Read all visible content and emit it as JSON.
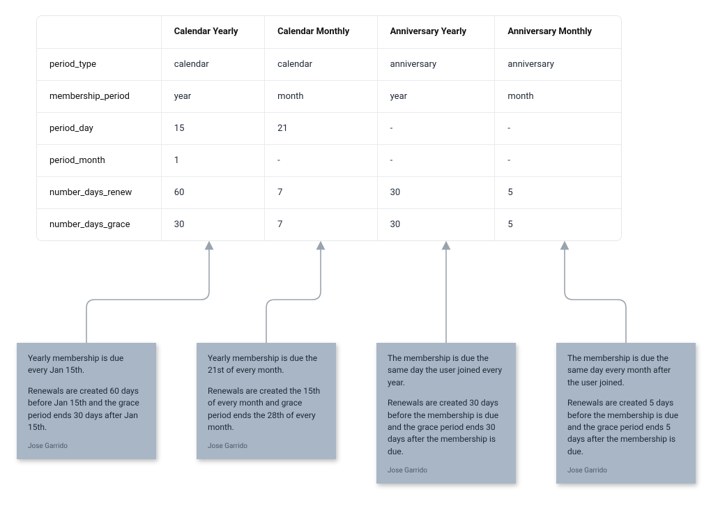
{
  "table": {
    "headers": [
      "",
      "Calendar Yearly",
      "Calendar Monthly",
      "Anniversary Yearly",
      "Anniversary Monthly"
    ],
    "rows": [
      {
        "label": "period_type",
        "values": [
          "calendar",
          "calendar",
          "anniversary",
          "anniversary"
        ]
      },
      {
        "label": "membership_period",
        "values": [
          "year",
          "month",
          "year",
          "month"
        ]
      },
      {
        "label": "period_day",
        "values": [
          "15",
          "21",
          "-",
          "-"
        ]
      },
      {
        "label": "period_month",
        "values": [
          "1",
          "-",
          "-",
          "-"
        ]
      },
      {
        "label": "number_days_renew",
        "values": [
          "60",
          "7",
          "30",
          "5"
        ]
      },
      {
        "label": "number_days_grace",
        "values": [
          "30",
          "7",
          "30",
          "5"
        ]
      }
    ]
  },
  "notes": [
    {
      "p1": "Yearly membership is due every Jan 15th.",
      "p2": "Renewals are created 60 days before Jan 15th and the grace period ends 30 days after Jan 15th.",
      "author": "Jose Garrido"
    },
    {
      "p1": "Yearly membership is due the 21st of every month.",
      "p2": "Renewals are created the 15th of every month and grace period ends the 28th of every month.",
      "author": "Jose Garrido"
    },
    {
      "p1": "The membership is due the same day the user joined every year.",
      "p2": "Renewals are created 30 days before the membership is due and the grace period ends 30 days after the membership is due.",
      "author": "Jose Garrido"
    },
    {
      "p1": "The membership is due the same day every month after the user joined.",
      "p2": "Renewals are created 5 days before the membership is due and the grace period ends 5 days after the membership is due.",
      "author": "Jose Garrido"
    }
  ],
  "arrow_color": "#9aa3ad"
}
